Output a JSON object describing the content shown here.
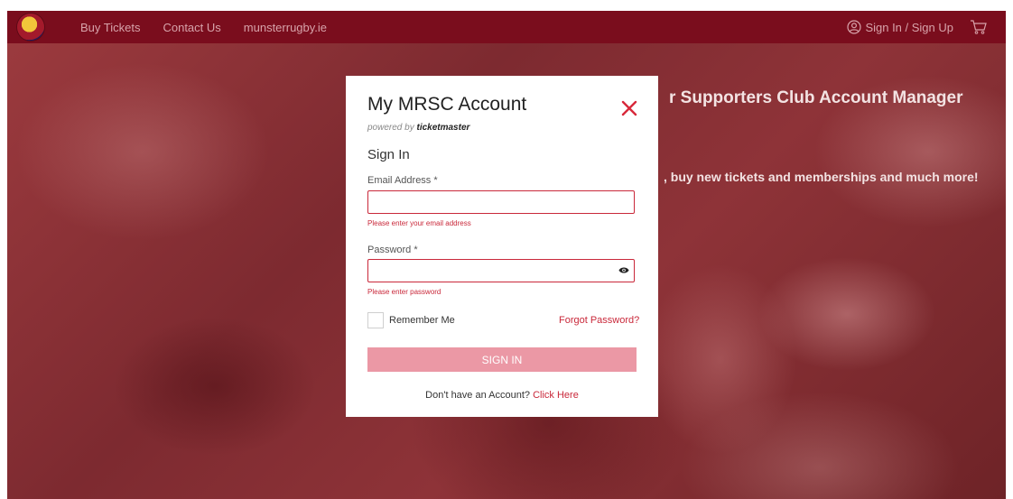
{
  "nav": {
    "links": [
      "Buy Tickets",
      "Contact Us",
      "munsterrugby.ie"
    ],
    "signin_label": "Sign In / Sign Up"
  },
  "hero": {
    "title": "r Supporters Club Account Manager",
    "subtitle": ", buy new tickets and memberships and much more!"
  },
  "modal": {
    "title": "My MRSC Account",
    "powered_prefix": "powered by",
    "powered_brand": "ticketmaster",
    "section_heading": "Sign In",
    "email": {
      "label": "Email Address *",
      "value": "",
      "error": "Please enter your email address"
    },
    "password": {
      "label": "Password *",
      "value": "",
      "error": "Please enter password"
    },
    "remember_label": "Remember Me",
    "forgot_label": "Forgot Password?",
    "signin_button": "SIGN IN",
    "no_account_text": "Don't have an Account?",
    "click_here": "Click Here"
  },
  "colors": {
    "nav_bg": "#7a0d1d",
    "accent": "#c9283a",
    "button_bg": "#eb98a5"
  },
  "icons": [
    "logo",
    "user-icon",
    "cart-icon",
    "close-icon",
    "eye-icon"
  ]
}
